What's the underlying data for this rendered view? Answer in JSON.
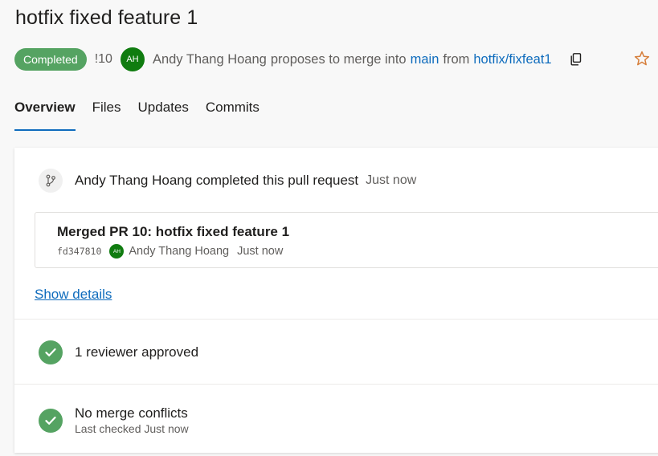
{
  "pr": {
    "title": "hotfix fixed feature 1",
    "status": "Completed",
    "id": "!10",
    "author_initials": "AH",
    "author": "Andy Thang Hoang",
    "proposes_text": "proposes to merge into",
    "target_branch": "main",
    "from_text": "from",
    "source_branch": "hotfix/fixfeat1"
  },
  "tabs": [
    {
      "label": "Overview",
      "active": true
    },
    {
      "label": "Files",
      "active": false
    },
    {
      "label": "Updates",
      "active": false
    },
    {
      "label": "Commits",
      "active": false
    }
  ],
  "activity": {
    "event_text": "Andy Thang Hoang completed this pull request",
    "event_time": "Just now",
    "commit_title": "Merged PR 10: hotfix fixed feature 1",
    "commit_hash": "fd347810",
    "commit_author_initials": "AH",
    "commit_author": "Andy Thang Hoang",
    "commit_time": "Just now",
    "show_details": "Show details"
  },
  "checks": {
    "reviewers": "1 reviewer approved",
    "merge_title": "No merge conflicts",
    "merge_sub": "Last checked Just now"
  },
  "colors": {
    "accent": "#0f6cbd",
    "success": "#55a362",
    "avatar": "#107c10"
  },
  "icons": {
    "copy": "copy-icon",
    "star": "star-icon",
    "pr_completed": "pull-request-icon",
    "check": "checkmark-icon"
  }
}
